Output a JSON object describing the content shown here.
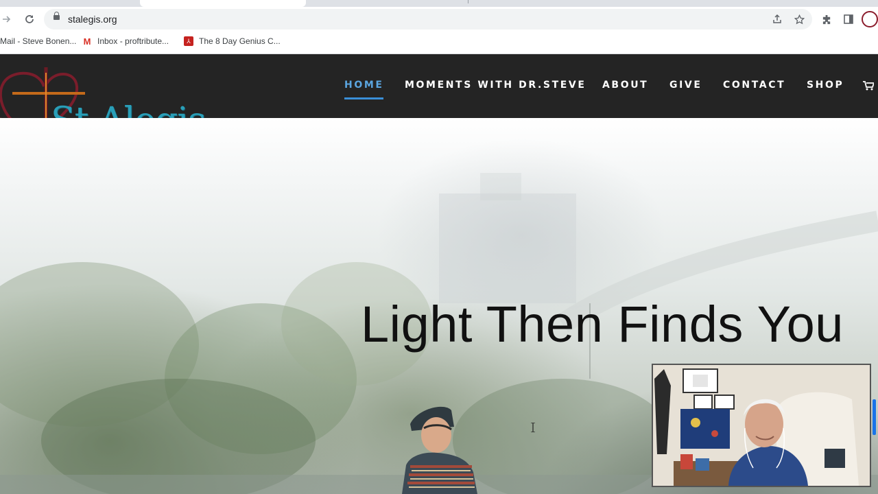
{
  "browser": {
    "url": "stalegis.org",
    "bookmarks": [
      {
        "label": "Mail - Steve Bonen...",
        "icon": "mail-icon"
      },
      {
        "label": "Inbox - proftribute...",
        "icon": "gmail-icon"
      },
      {
        "label": "The 8 Day Genius C...",
        "icon": "pdf-icon"
      }
    ]
  },
  "site": {
    "logo_text": "St.Alegis",
    "nav": [
      "HOME",
      "MOMENTS WITH DR.STEVE",
      "ABOUT",
      "GIVE",
      "CONTACT",
      "SHOP"
    ],
    "active_nav": "HOME"
  },
  "hero": {
    "title": "Light Then Finds You"
  },
  "colors": {
    "header_bg": "#242424",
    "nav_active": "#5ba6e1",
    "logo_teal": "#2a9fb8",
    "logo_maroon": "#7a1d2b"
  }
}
